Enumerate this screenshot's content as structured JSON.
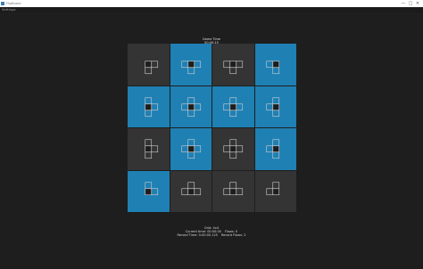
{
  "window": {
    "title": "FlipBoard",
    "controls": {
      "minimize": "—",
      "maximize": "□",
      "close": "✕"
    }
  },
  "menu": {
    "settings_label": "Settings"
  },
  "game_time": {
    "label": "Game Time",
    "value": "00:00:15"
  },
  "board": {
    "rows": 4,
    "cols": 4,
    "colors": {
      "on": "#1f80b4",
      "off": "#343434",
      "icon_line": "#cfcfcf",
      "icon_fill": "#1d1d1d"
    },
    "tiles": [
      {
        "state": "off",
        "pattern": "corner-tl"
      },
      {
        "state": "on",
        "pattern": "edge-top"
      },
      {
        "state": "off",
        "pattern": "edge-top"
      },
      {
        "state": "on",
        "pattern": "corner-tr"
      },
      {
        "state": "on",
        "pattern": "edge-left"
      },
      {
        "state": "on",
        "pattern": "center"
      },
      {
        "state": "on",
        "pattern": "center"
      },
      {
        "state": "on",
        "pattern": "edge-right"
      },
      {
        "state": "off",
        "pattern": "edge-left"
      },
      {
        "state": "on",
        "pattern": "center"
      },
      {
        "state": "off",
        "pattern": "center"
      },
      {
        "state": "on",
        "pattern": "edge-right"
      },
      {
        "state": "on",
        "pattern": "corner-bl"
      },
      {
        "state": "off",
        "pattern": "edge-bottom"
      },
      {
        "state": "off",
        "pattern": "edge-bottom"
      },
      {
        "state": "off",
        "pattern": "corner-br"
      }
    ]
  },
  "status": {
    "grid_label": "Grid: 4x4",
    "current_time_label": "Current time: 00:00:00",
    "flows_label": "Flows: 0",
    "record_time_label": "Record Time: 0:00:00.125",
    "record_flows_label": "Record Flows: 2"
  }
}
